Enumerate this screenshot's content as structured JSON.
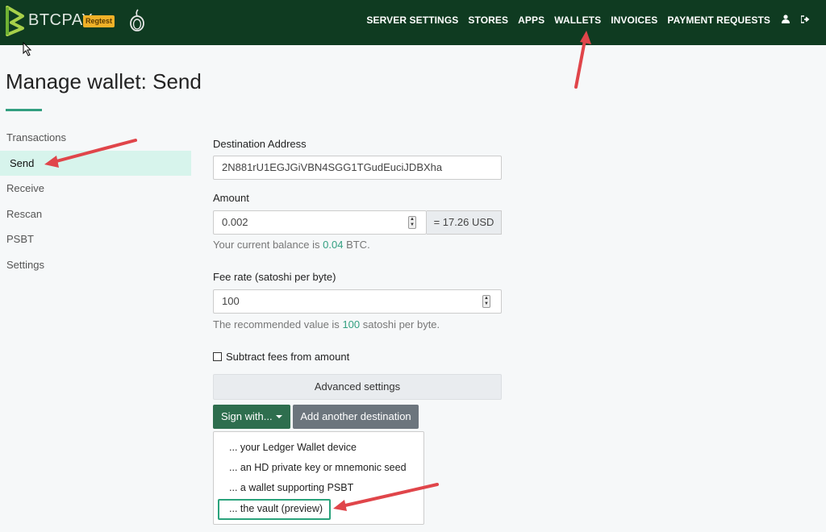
{
  "header": {
    "brand": "BTCPAY",
    "badge": "Regtest",
    "nav": [
      "SERVER SETTINGS",
      "STORES",
      "APPS",
      "WALLETS",
      "INVOICES",
      "PAYMENT REQUESTS"
    ],
    "icons": [
      "user-icon",
      "sign-out-icon"
    ]
  },
  "page": {
    "title": "Manage wallet: Send"
  },
  "sidebar": {
    "items": [
      {
        "label": "Transactions"
      },
      {
        "label": "Send"
      },
      {
        "label": "Receive"
      },
      {
        "label": "Rescan"
      },
      {
        "label": "PSBT"
      },
      {
        "label": "Settings"
      }
    ],
    "active": "Send"
  },
  "form": {
    "destination": {
      "label": "Destination Address",
      "value": "2N881rU1EGJGiVBN4SGG1TGudEuciJDBXha"
    },
    "amount": {
      "label": "Amount",
      "value": "0.002",
      "fiat": "= 17.26 USD"
    },
    "balance": {
      "prefix": "Your current balance is",
      "value": "0.04",
      "suffix": "BTC."
    },
    "fee": {
      "label": "Fee rate (satoshi per byte)",
      "value": "100"
    },
    "fee_help": {
      "prefix": "The recommended value is",
      "value": "100",
      "suffix": "satoshi per byte."
    },
    "subtract_fees": {
      "label": "Subtract fees from amount",
      "checked": false
    },
    "advanced": "Advanced settings",
    "sign_with": "Sign with...",
    "add_destination": "Add another destination",
    "sign_options": [
      "... your Ledger Wallet device",
      "... an HD private key or mnemonic seed",
      "... a wallet supporting PSBT",
      "... the vault (preview)"
    ]
  },
  "colors": {
    "navbar": "#0f3b21",
    "accent": "#329f80",
    "active_bg": "#d7f4ec",
    "primary_button": "#2e6e4e",
    "secondary_button": "#6c757d",
    "annotation_arrow": "#e0454a",
    "highlight": "#2aa37c"
  }
}
